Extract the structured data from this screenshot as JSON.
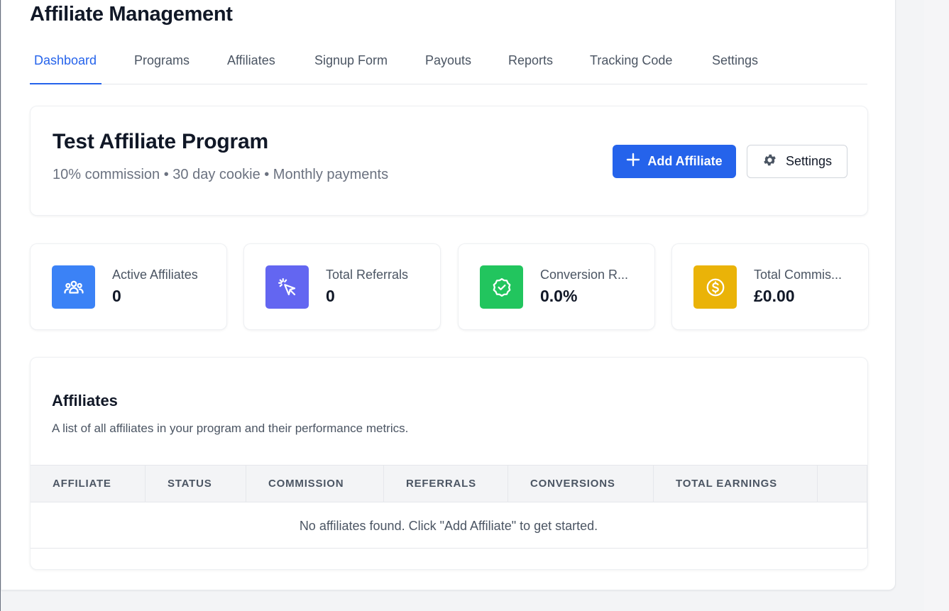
{
  "page": {
    "title": "Affiliate Management"
  },
  "tabs": [
    {
      "label": "Dashboard",
      "active": true
    },
    {
      "label": "Programs"
    },
    {
      "label": "Affiliates"
    },
    {
      "label": "Signup Form"
    },
    {
      "label": "Payouts"
    },
    {
      "label": "Reports"
    },
    {
      "label": "Tracking Code"
    },
    {
      "label": "Settings"
    }
  ],
  "program": {
    "name": "Test Affiliate Program",
    "summary": "10% commission • 30 day cookie • Monthly payments",
    "add_button_label": "Add Affiliate",
    "settings_button_label": "Settings"
  },
  "stats": [
    {
      "label": "Active Affiliates",
      "value": "0",
      "icon": "users-icon",
      "color": "#3b82f6"
    },
    {
      "label": "Total Referrals",
      "value": "0",
      "icon": "cursor-click-icon",
      "color": "#6366f1"
    },
    {
      "label": "Conversion R...",
      "value": "0.0%",
      "icon": "badge-check-icon",
      "color": "#22c55e"
    },
    {
      "label": "Total Commis...",
      "value": "£0.00",
      "icon": "currency-icon",
      "color": "#eab308"
    }
  ],
  "affiliates": {
    "title": "Affiliates",
    "description": "A list of all affiliates in your program and their performance metrics.",
    "columns": [
      "AFFILIATE",
      "STATUS",
      "COMMISSION",
      "REFERRALS",
      "CONVERSIONS",
      "TOTAL EARNINGS"
    ],
    "empty_message": "No affiliates found. Click \"Add Affiliate\" to get started."
  },
  "colors": {
    "accent": "#2563eb"
  }
}
